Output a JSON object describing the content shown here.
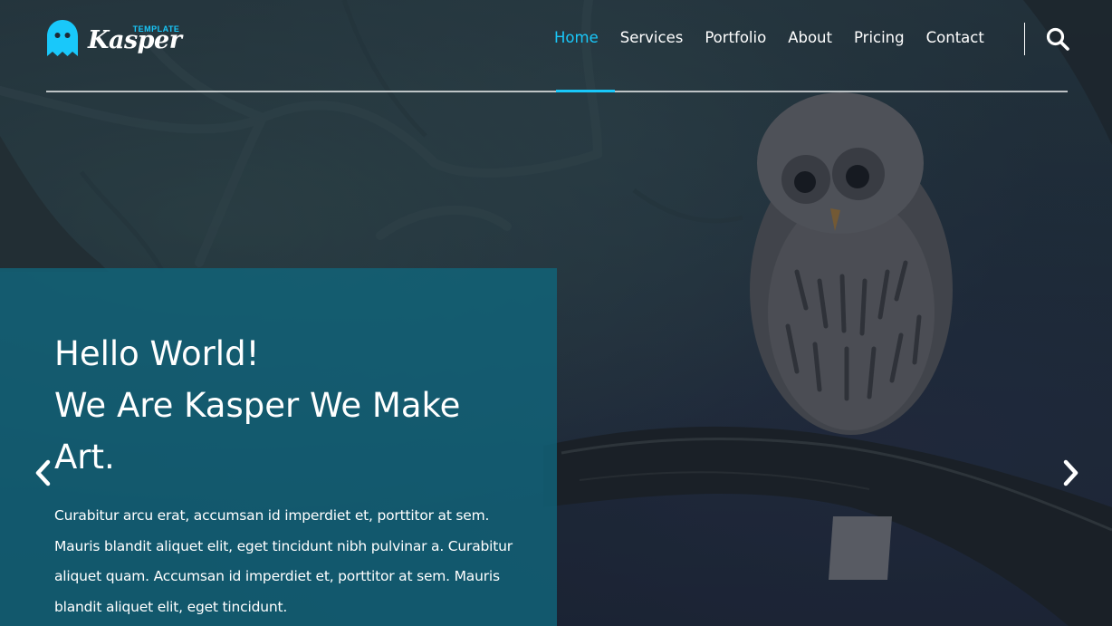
{
  "brand": {
    "name": "Kasper",
    "tag": "TEMPLATE",
    "accent_color": "#19c8fa"
  },
  "nav": {
    "items": [
      {
        "label": "Home",
        "active": true
      },
      {
        "label": "Services",
        "active": false
      },
      {
        "label": "Portfolio",
        "active": false
      },
      {
        "label": "About",
        "active": false
      },
      {
        "label": "Pricing",
        "active": false
      },
      {
        "label": "Contact",
        "active": false
      }
    ],
    "search_icon": "search-icon"
  },
  "hero": {
    "headline_line1": "Hello World!",
    "headline_line2": "We Are Kasper We Make",
    "headline_line3": "Art.",
    "description": "Curabitur arcu erat, accumsan id imperdiet et, porttitor at sem. Mauris blandit aliquet elit, eget tincidunt nibh pulvinar a. Curabitur aliquet quam. Accumsan id imperdiet et, porttitor at sem. Mauris blandit aliquet elit, eget tincidunt.",
    "panel_color": "#11647a",
    "prev_icon": "chevron-left-icon",
    "next_icon": "chevron-right-icon"
  }
}
